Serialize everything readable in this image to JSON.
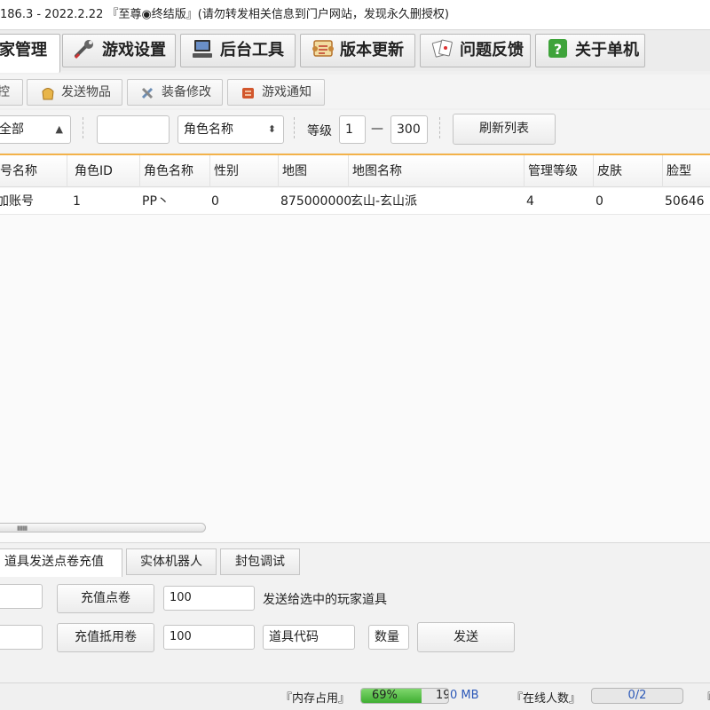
{
  "window": {
    "title": "186.3 - 2022.2.22 『至尊◉终结版』(请勿转发相关信息到门户网站，发现永久删授权)"
  },
  "main_tabs": [
    {
      "label": "家管理",
      "icon": "people-icon",
      "active": true
    },
    {
      "label": "游戏设置",
      "icon": "wrench-icon",
      "active": false
    },
    {
      "label": "后台工具",
      "icon": "computer-icon",
      "active": false
    },
    {
      "label": "版本更新",
      "icon": "scroll-icon",
      "active": false
    },
    {
      "label": "问题反馈",
      "icon": "cards-icon",
      "active": false
    },
    {
      "label": "关于单机",
      "icon": "help-icon",
      "active": false
    }
  ],
  "sub_tabs": [
    {
      "label": "控",
      "icon": ""
    },
    {
      "label": "发送物品",
      "icon": "bag-icon"
    },
    {
      "label": "装备修改",
      "icon": "tools-icon"
    },
    {
      "label": "游戏通知",
      "icon": "notice-icon"
    }
  ],
  "filters": {
    "scope_select": "全部",
    "search_value": "",
    "field_select": "角色名称",
    "level_label": "等级",
    "level_min": "1",
    "level_dash": "—",
    "level_max": "300",
    "refresh_button": "刷新列表"
  },
  "table": {
    "columns": [
      "号名称",
      "角色ID",
      "角色名称",
      "性别",
      "地图",
      "地图名称",
      "管理等级",
      "皮肤",
      "脸型"
    ],
    "rows": [
      [
        "加账号",
        "1",
        "PP丶",
        "0",
        "875000000",
        "玄山-玄山派",
        "4",
        "0",
        "50646"
      ]
    ]
  },
  "bottom_tabs": [
    {
      "label": "道具发送点卷充值",
      "active": true
    },
    {
      "label": "实体机器人",
      "active": false
    },
    {
      "label": "封包调试",
      "active": false
    }
  ],
  "recharge": {
    "row1_input": "",
    "points_button": "充值点卷",
    "points_amount": "100",
    "send_hint": "发送给选中的玩家道具",
    "row2_input": "",
    "voucher_button": "充值抵用卷",
    "voucher_amount": "100",
    "item_code_placeholder": "道具代码",
    "quantity_placeholder": "数量",
    "send_button": "发送"
  },
  "status": {
    "memory_label": "『内存占用』",
    "memory_percent_text": "69%",
    "memory_fraction": 0.69,
    "memory_size_text": "19",
    "memory_unit_text": "0 MB",
    "online_label": "『在线人数』",
    "online_value": "0/2",
    "trailing": "『"
  },
  "colors": {
    "accent_orange": "#f3b24a",
    "progress_green": "#3fae32",
    "online_text": "#2b58b8"
  }
}
